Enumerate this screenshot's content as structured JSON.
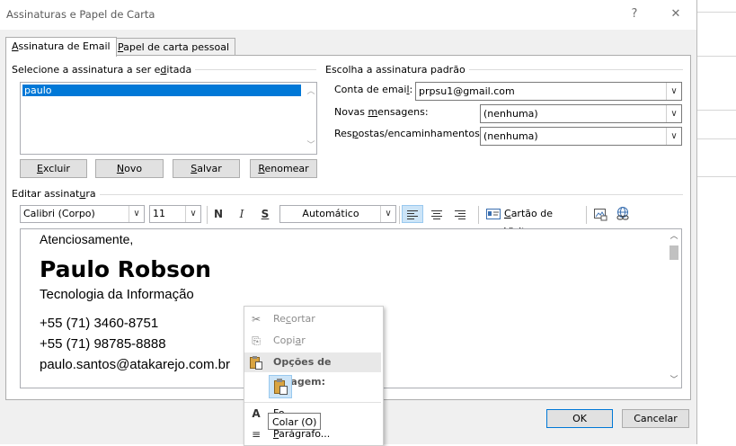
{
  "window": {
    "title": "Assinaturas e Papel de Carta",
    "help": "?",
    "close": "✕"
  },
  "tabs": [
    {
      "prefix": "A",
      "rest": "ssinatura de Email"
    },
    {
      "prefix": "P",
      "rest": "apel de carta pessoal"
    }
  ],
  "select_group": {
    "before": "Selecione a assinatura a ser e",
    "ul": "d",
    "after": "itada"
  },
  "signatures": [
    "paulo"
  ],
  "buttons": {
    "delete": {
      "ul": "E",
      "rest": "xcluir"
    },
    "new": {
      "ul": "N",
      "rest": "ovo"
    },
    "save": {
      "ul": "S",
      "rest": "alvar"
    },
    "rename": {
      "ul": "R",
      "rest": "enomear"
    },
    "ok": "OK",
    "cancel": "Cancelar"
  },
  "default_group": {
    "label": "Escolha a assinatura padrão",
    "account_label_before": "Conta de emai",
    "account_label_ul": "l",
    "account_label_after": ":",
    "account_value": "prpsu1@gmail.com",
    "new_label_before": "Novas ",
    "new_label_ul": "m",
    "new_label_after": "ensagens:",
    "new_value": "(nenhuma)",
    "reply_label_before": "Res",
    "reply_label_ul": "p",
    "reply_label_after": "ostas/encaminhamentos:",
    "reply_value": "(nenhuma)"
  },
  "edit_group": {
    "before": "Editar assinat",
    "ul": "u",
    "after": "ra"
  },
  "toolbar": {
    "font": "Calibri (Corpo)",
    "size": "11",
    "bold": "N",
    "italic": "I",
    "underline": "S",
    "color": "Automático",
    "business_card_ul": "C",
    "business_card_rest": "artão de Visita"
  },
  "signature_content": {
    "closing": "Atenciosamente,",
    "name": "Paulo Robson",
    "department": "Tecnologia da Informação",
    "phone1": "+55 (71) 3460-8751",
    "phone2": "+55 (71) 98785-8888",
    "email": "paulo.santos@atakarejo.com.br"
  },
  "context_menu": {
    "cut_before": "Re",
    "cut_ul": "c",
    "cut_after": "ortar",
    "copy_before": "Copi",
    "copy_ul": "a",
    "copy_after": "r",
    "paste_header": "Opções de Colagem:",
    "font_partial": "Fo",
    "paragraph_ul": "P",
    "paragraph_rest": "arágrafo..."
  },
  "tooltip": "Colar (O)"
}
